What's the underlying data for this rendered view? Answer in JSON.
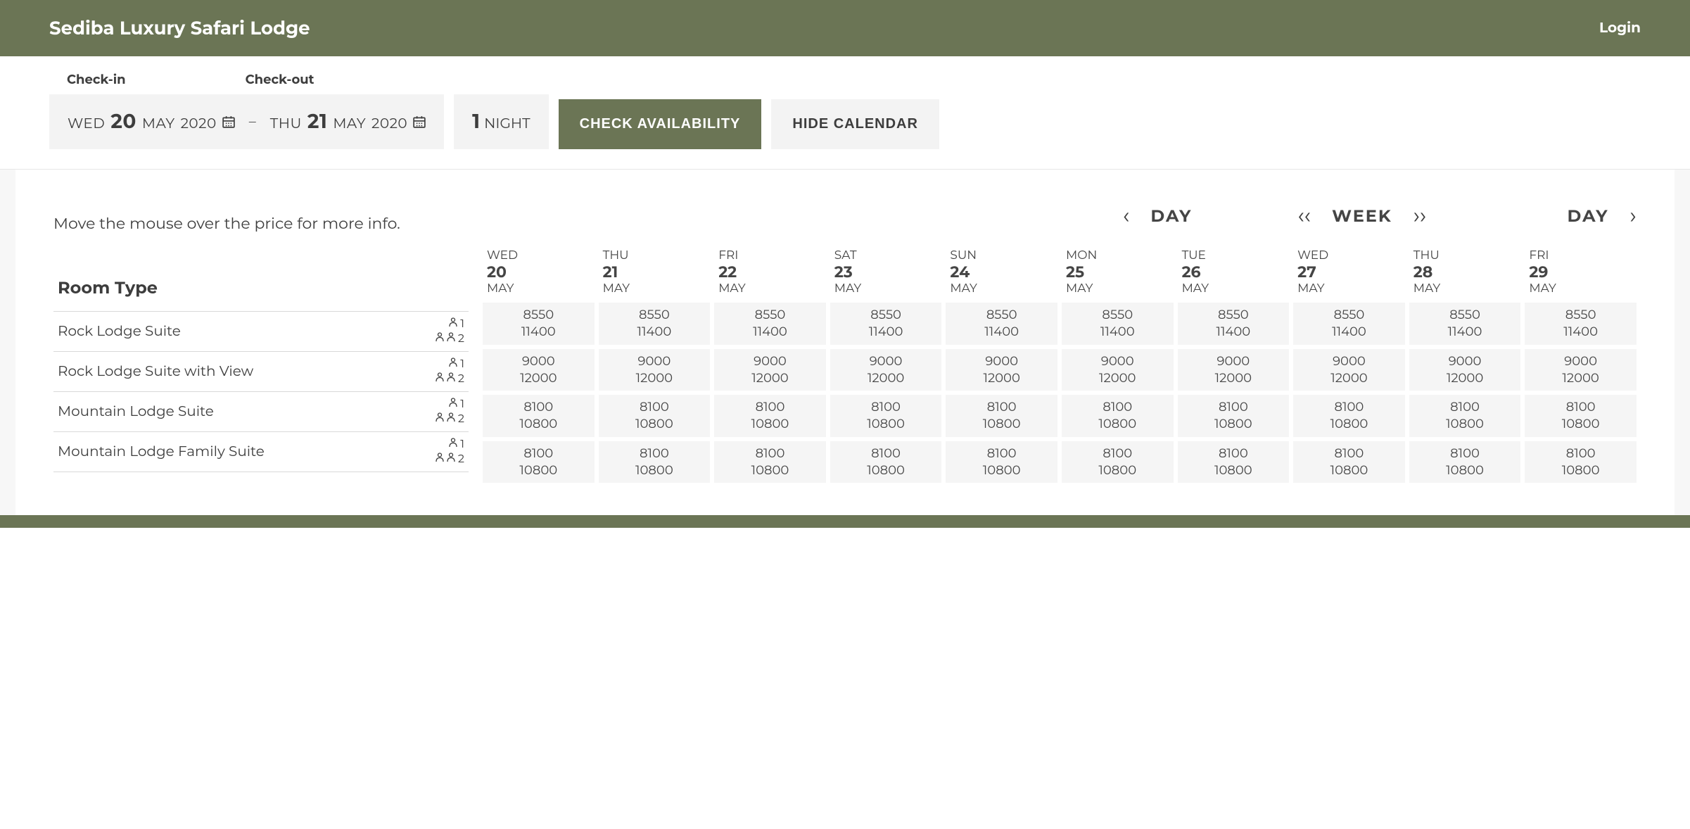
{
  "header": {
    "title": "Sediba Luxury Safari Lodge",
    "login": "Login"
  },
  "search": {
    "checkin_label": "Check-in",
    "checkout_label": "Check-out",
    "checkin": {
      "dow": "WED",
      "day": "20",
      "month": "MAY",
      "year": "2020"
    },
    "checkout": {
      "dow": "THU",
      "day": "21",
      "month": "MAY",
      "year": "2020"
    },
    "dash": "–",
    "nights_count": "1",
    "nights_label": "NIGHT",
    "check_btn": "CHECK AVAILABILITY",
    "hide_btn": "HIDE CALENDAR"
  },
  "hint": "Move the mouse over the price for more info.",
  "nav": {
    "day": "DAY",
    "week": "WEEK",
    "prev_day": "‹",
    "next_day": "›",
    "prev_week": "‹‹",
    "next_week": "››"
  },
  "room_header": "Room Type",
  "occupancy_labels": {
    "single": "1",
    "double": "2"
  },
  "dates": [
    {
      "dow": "WED",
      "day": "20",
      "month": "MAY"
    },
    {
      "dow": "THU",
      "day": "21",
      "month": "MAY"
    },
    {
      "dow": "FRI",
      "day": "22",
      "month": "MAY"
    },
    {
      "dow": "SAT",
      "day": "23",
      "month": "MAY"
    },
    {
      "dow": "SUN",
      "day": "24",
      "month": "MAY"
    },
    {
      "dow": "MON",
      "day": "25",
      "month": "MAY"
    },
    {
      "dow": "TUE",
      "day": "26",
      "month": "MAY"
    },
    {
      "dow": "WED",
      "day": "27",
      "month": "MAY"
    },
    {
      "dow": "THU",
      "day": "28",
      "month": "MAY"
    },
    {
      "dow": "FRI",
      "day": "29",
      "month": "MAY"
    }
  ],
  "rooms": [
    {
      "name": "Rock Lodge Suite",
      "prices": [
        {
          "p1": "8550",
          "p2": "11400"
        },
        {
          "p1": "8550",
          "p2": "11400"
        },
        {
          "p1": "8550",
          "p2": "11400"
        },
        {
          "p1": "8550",
          "p2": "11400"
        },
        {
          "p1": "8550",
          "p2": "11400"
        },
        {
          "p1": "8550",
          "p2": "11400"
        },
        {
          "p1": "8550",
          "p2": "11400"
        },
        {
          "p1": "8550",
          "p2": "11400"
        },
        {
          "p1": "8550",
          "p2": "11400"
        },
        {
          "p1": "8550",
          "p2": "11400"
        }
      ]
    },
    {
      "name": "Rock Lodge Suite with View",
      "prices": [
        {
          "p1": "9000",
          "p2": "12000"
        },
        {
          "p1": "9000",
          "p2": "12000"
        },
        {
          "p1": "9000",
          "p2": "12000"
        },
        {
          "p1": "9000",
          "p2": "12000"
        },
        {
          "p1": "9000",
          "p2": "12000"
        },
        {
          "p1": "9000",
          "p2": "12000"
        },
        {
          "p1": "9000",
          "p2": "12000"
        },
        {
          "p1": "9000",
          "p2": "12000"
        },
        {
          "p1": "9000",
          "p2": "12000"
        },
        {
          "p1": "9000",
          "p2": "12000"
        }
      ]
    },
    {
      "name": "Mountain Lodge Suite",
      "prices": [
        {
          "p1": "8100",
          "p2": "10800"
        },
        {
          "p1": "8100",
          "p2": "10800"
        },
        {
          "p1": "8100",
          "p2": "10800"
        },
        {
          "p1": "8100",
          "p2": "10800"
        },
        {
          "p1": "8100",
          "p2": "10800"
        },
        {
          "p1": "8100",
          "p2": "10800"
        },
        {
          "p1": "8100",
          "p2": "10800"
        },
        {
          "p1": "8100",
          "p2": "10800"
        },
        {
          "p1": "8100",
          "p2": "10800"
        },
        {
          "p1": "8100",
          "p2": "10800"
        }
      ]
    },
    {
      "name": "Mountain Lodge Family Suite",
      "prices": [
        {
          "p1": "8100",
          "p2": "10800"
        },
        {
          "p1": "8100",
          "p2": "10800"
        },
        {
          "p1": "8100",
          "p2": "10800"
        },
        {
          "p1": "8100",
          "p2": "10800"
        },
        {
          "p1": "8100",
          "p2": "10800"
        },
        {
          "p1": "8100",
          "p2": "10800"
        },
        {
          "p1": "8100",
          "p2": "10800"
        },
        {
          "p1": "8100",
          "p2": "10800"
        },
        {
          "p1": "8100",
          "p2": "10800"
        },
        {
          "p1": "8100",
          "p2": "10800"
        }
      ]
    }
  ]
}
